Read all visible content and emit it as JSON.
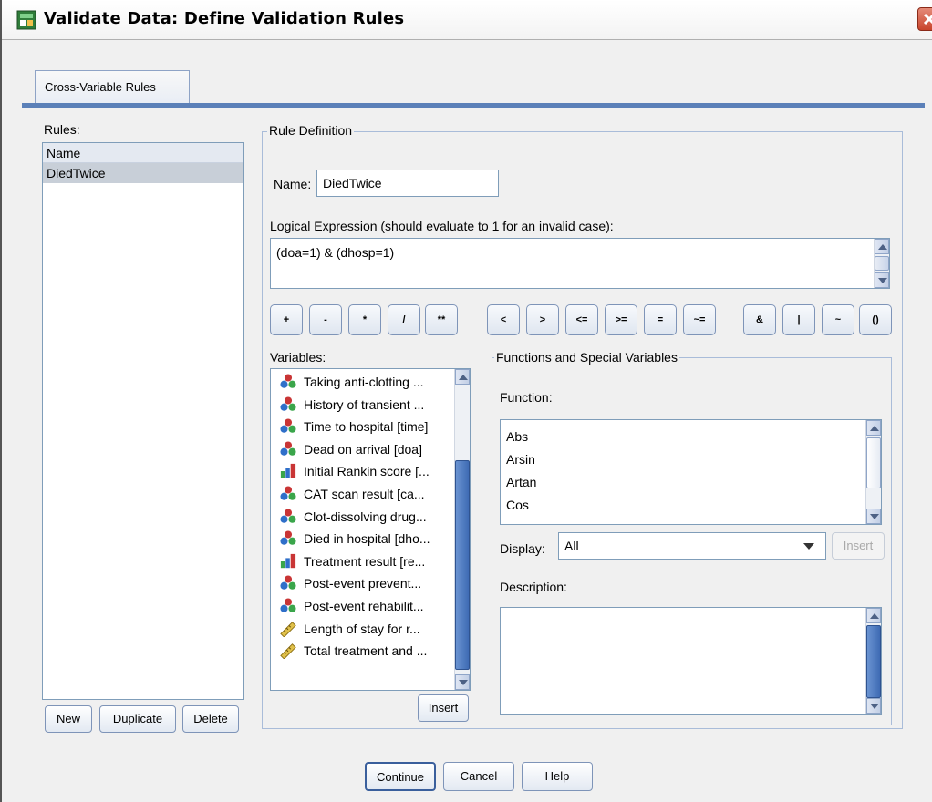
{
  "window": {
    "title": "Validate Data: Define Validation Rules"
  },
  "tabs": [
    {
      "label": "Cross-Variable Rules"
    }
  ],
  "rules_panel": {
    "label": "Rules:",
    "items": [
      "Name",
      "DiedTwice"
    ],
    "buttons": {
      "new": "New",
      "duplicate": "Duplicate",
      "delete": "Delete"
    }
  },
  "rule_definition": {
    "title": "Rule Definition",
    "name_label": "Name:",
    "name_value": "DiedTwice",
    "expression_label": "Logical Expression (should evaluate to 1 for an invalid case):",
    "expression_value": "(doa=1) & (dhosp=1)",
    "operators": [
      "+",
      "-",
      "*",
      "/",
      "**",
      "<",
      ">",
      "<=",
      ">=",
      "=",
      "~=",
      "&",
      "|",
      "~",
      "()"
    ]
  },
  "variables": {
    "label": "Variables:",
    "items": [
      {
        "text": "Taking anti-clotting ...",
        "icon": "nominal-icon"
      },
      {
        "text": "History of transient ...",
        "icon": "nominal-icon"
      },
      {
        "text": "Time to hospital [time]",
        "icon": "nominal-icon"
      },
      {
        "text": "Dead on arrival [doa]",
        "icon": "nominal-icon"
      },
      {
        "text": "Initial Rankin score [...",
        "icon": "ordinal-icon"
      },
      {
        "text": "CAT scan result [ca...",
        "icon": "nominal-icon"
      },
      {
        "text": "Clot-dissolving drug...",
        "icon": "nominal-icon"
      },
      {
        "text": "Died in hospital [dho...",
        "icon": "nominal-icon"
      },
      {
        "text": "Treatment result [re...",
        "icon": "ordinal-icon"
      },
      {
        "text": "Post-event prevent...",
        "icon": "nominal-icon"
      },
      {
        "text": "Post-event rehabilit...",
        "icon": "nominal-icon"
      },
      {
        "text": "Length of stay for r...",
        "icon": "scale-icon"
      },
      {
        "text": "Total treatment and ...",
        "icon": "scale-icon"
      }
    ],
    "insert_label": "Insert"
  },
  "functions": {
    "title": "Functions and Special Variables",
    "function_label": "Function:",
    "items": [
      "Abs",
      "Arsin",
      "Artan",
      "Cos"
    ],
    "display_label": "Display:",
    "display_value": "All",
    "insert_label": "Insert",
    "description_label": "Description:"
  },
  "footer": {
    "continue": "Continue",
    "cancel": "Cancel",
    "help": "Help"
  },
  "colors": {
    "accent": "#5b80b8",
    "selection": "#c8cfd8",
    "scroll_thumb": "#4a78bf"
  }
}
